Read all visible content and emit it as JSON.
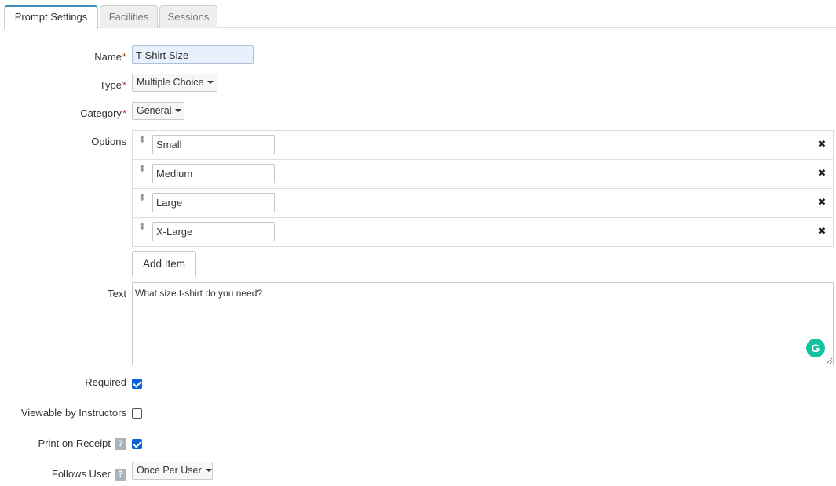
{
  "tabs": [
    {
      "label": "Prompt Settings",
      "active": true
    },
    {
      "label": "Facilities",
      "active": false
    },
    {
      "label": "Sessions",
      "active": false
    }
  ],
  "form": {
    "name": {
      "label": "Name",
      "required_mark": "*",
      "value": "T-Shirt Size"
    },
    "type": {
      "label": "Type",
      "required_mark": "*",
      "value": "Multiple Choice"
    },
    "category": {
      "label": "Category",
      "required_mark": "*",
      "value": "General"
    },
    "options": {
      "label": "Options",
      "items": [
        "Small",
        "Medium",
        "Large",
        "X-Large"
      ],
      "drag_icon": "⬍",
      "remove_icon": "✖",
      "add_label": "Add Item"
    },
    "text": {
      "label": "Text",
      "value": "What size t-shirt do you need?"
    },
    "required": {
      "label": "Required",
      "checked": true
    },
    "viewable": {
      "label": "Viewable by Instructors",
      "checked": false
    },
    "print_receipt": {
      "label": "Print on Receipt",
      "help": "?",
      "checked": true
    },
    "follows_user": {
      "label": "Follows User",
      "help": "?",
      "value": "Once Per User"
    }
  },
  "grammarly_icon": "G",
  "colors": {
    "accent": "#0b62d6",
    "required": "#c0392b",
    "grammarly": "#15c39a"
  }
}
